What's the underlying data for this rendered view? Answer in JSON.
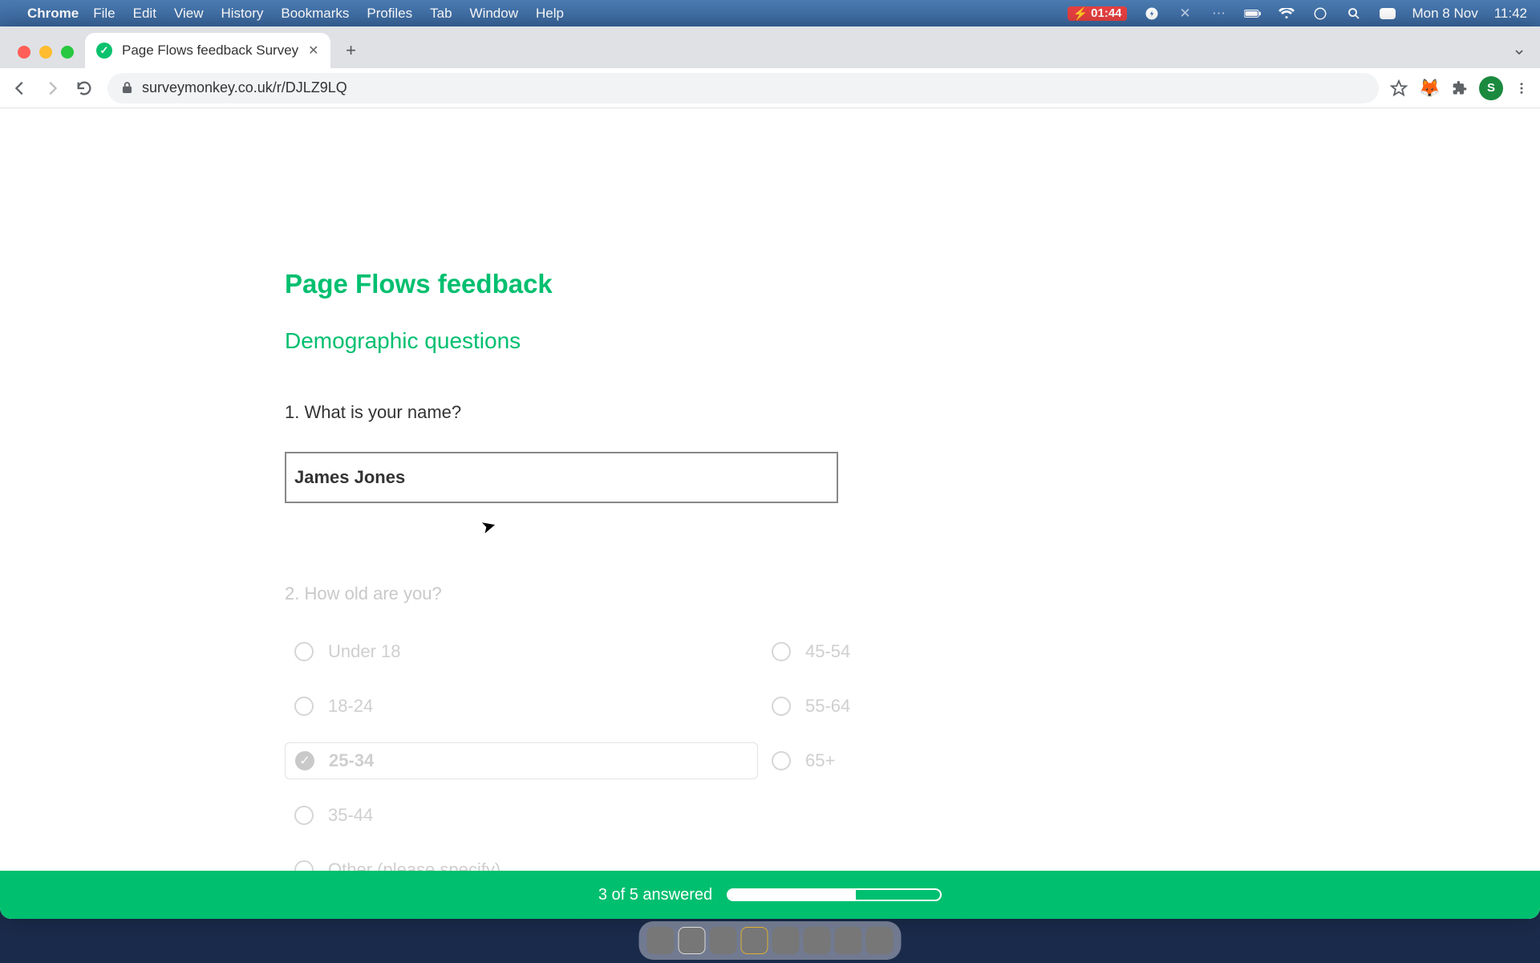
{
  "menubar": {
    "app": "Chrome",
    "items": [
      "File",
      "Edit",
      "View",
      "History",
      "Bookmarks",
      "Profiles",
      "Tab",
      "Window",
      "Help"
    ],
    "battery_time": "01:44",
    "date": "Mon 8 Nov",
    "clock": "11:42"
  },
  "browser": {
    "tab_title": "Page Flows feedback Survey",
    "url": "surveymonkey.co.uk/r/DJLZ9LQ",
    "avatar_initial": "S"
  },
  "survey": {
    "title": "Page Flows feedback",
    "section": "Demographic questions",
    "q1": {
      "number": "1.",
      "text": "What is your name?",
      "value": "James Jones"
    },
    "q2": {
      "number": "2.",
      "text": "How old are you?",
      "options_left": [
        "Under 18",
        "18-24",
        "25-34",
        "35-44",
        "Other (please specify)"
      ],
      "options_right": [
        "45-54",
        "55-64",
        "65+"
      ],
      "selected": "25-34"
    },
    "progress": {
      "label": "3 of 5 answered",
      "pct": 60
    }
  }
}
